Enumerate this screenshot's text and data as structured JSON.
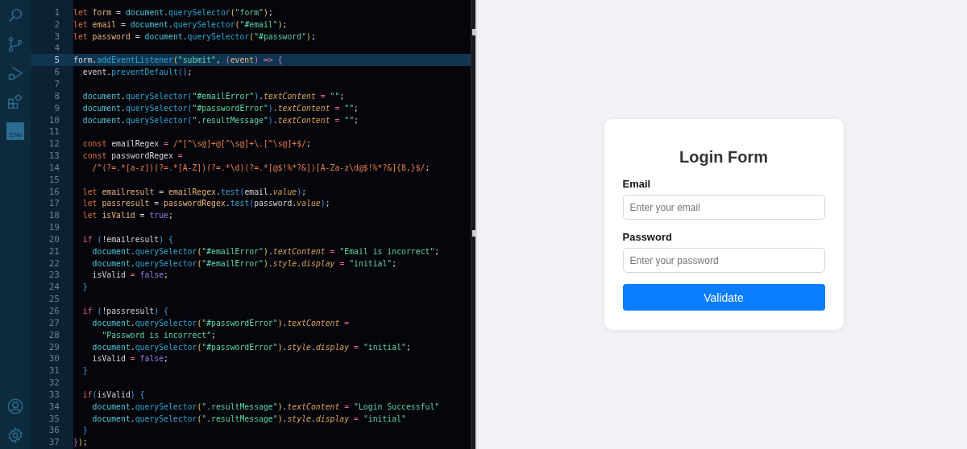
{
  "editor": {
    "lines": [
      {
        "number": "1",
        "selected": false,
        "tokens": [
          {
            "text": "let",
            "kind": "kw"
          },
          {
            "text": " form",
            "kind": "var"
          },
          {
            "text": " = ",
            "kind": "plain"
          },
          {
            "text": "document",
            "kind": "obj"
          },
          {
            "text": ".",
            "kind": "plain"
          },
          {
            "text": "querySelector",
            "kind": "fn"
          },
          {
            "text": "(",
            "kind": "paren"
          },
          {
            "text": "\"form\"",
            "kind": "str"
          },
          {
            "text": ")",
            "kind": "paren"
          },
          {
            "text": ";",
            "kind": "plain"
          }
        ]
      },
      {
        "number": "2",
        "selected": false,
        "tokens": [
          {
            "text": "let",
            "kind": "kw"
          },
          {
            "text": " email",
            "kind": "var"
          },
          {
            "text": " = ",
            "kind": "plain"
          },
          {
            "text": "document",
            "kind": "obj"
          },
          {
            "text": ".",
            "kind": "plain"
          },
          {
            "text": "querySelector",
            "kind": "fn"
          },
          {
            "text": "(",
            "kind": "paren"
          },
          {
            "text": "\"#email\"",
            "kind": "str"
          },
          {
            "text": ")",
            "kind": "paren"
          },
          {
            "text": ";",
            "kind": "plain"
          }
        ]
      },
      {
        "number": "3",
        "selected": false,
        "tokens": [
          {
            "text": "let",
            "kind": "kw"
          },
          {
            "text": " password",
            "kind": "var"
          },
          {
            "text": " = ",
            "kind": "plain"
          },
          {
            "text": "document",
            "kind": "obj"
          },
          {
            "text": ".",
            "kind": "plain"
          },
          {
            "text": "querySelector",
            "kind": "fn"
          },
          {
            "text": "(",
            "kind": "paren"
          },
          {
            "text": "\"#password\"",
            "kind": "str"
          },
          {
            "text": ")",
            "kind": "paren"
          },
          {
            "text": ";",
            "kind": "plain"
          }
        ]
      },
      {
        "number": "4",
        "selected": false
      },
      {
        "number": "5",
        "selected": true,
        "tokens": [
          {
            "text": "form",
            "kind": "plain"
          },
          {
            "text": ".",
            "kind": "plain"
          },
          {
            "text": "addEventListener",
            "kind": "fn"
          },
          {
            "text": "(",
            "kind": "paren"
          },
          {
            "text": "\"submit\"",
            "kind": "str"
          },
          {
            "text": ", ",
            "kind": "plain"
          },
          {
            "text": "(",
            "kind": "bracket"
          },
          {
            "text": "event",
            "kind": "var"
          },
          {
            "text": ")",
            "kind": "bracket"
          },
          {
            "text": " => ",
            "kind": "op"
          },
          {
            "text": "{",
            "kind": "bracket"
          }
        ]
      },
      {
        "number": "6",
        "selected": false,
        "tokens": [
          {
            "text": "  event",
            "kind": "plain"
          },
          {
            "text": ".",
            "kind": "plain"
          },
          {
            "text": "preventDefault",
            "kind": "fn"
          },
          {
            "text": "()",
            "kind": "brace"
          },
          {
            "text": ";",
            "kind": "plain"
          }
        ]
      },
      {
        "number": "7",
        "selected": false
      },
      {
        "number": "8",
        "selected": false,
        "tokens": [
          {
            "text": "  document",
            "kind": "obj"
          },
          {
            "text": ".",
            "kind": "plain"
          },
          {
            "text": "querySelector",
            "kind": "fn"
          },
          {
            "text": "(",
            "kind": "brace"
          },
          {
            "text": "\"#emailError\"",
            "kind": "str"
          },
          {
            "text": ")",
            "kind": "brace"
          },
          {
            "text": ".",
            "kind": "plain"
          },
          {
            "text": "textContent",
            "kind": "prop"
          },
          {
            "text": " = ",
            "kind": "op"
          },
          {
            "text": "\"\"",
            "kind": "str"
          },
          {
            "text": ";",
            "kind": "plain"
          }
        ]
      },
      {
        "number": "9",
        "selected": false,
        "tokens": [
          {
            "text": "  document",
            "kind": "obj"
          },
          {
            "text": ".",
            "kind": "plain"
          },
          {
            "text": "querySelector",
            "kind": "fn"
          },
          {
            "text": "(",
            "kind": "brace"
          },
          {
            "text": "\"#passwordError\"",
            "kind": "str"
          },
          {
            "text": ")",
            "kind": "brace"
          },
          {
            "text": ".",
            "kind": "plain"
          },
          {
            "text": "textContent",
            "kind": "prop"
          },
          {
            "text": " = ",
            "kind": "op"
          },
          {
            "text": "\"\"",
            "kind": "str"
          },
          {
            "text": ";",
            "kind": "plain"
          }
        ]
      },
      {
        "number": "10",
        "selected": false,
        "tokens": [
          {
            "text": "  document",
            "kind": "obj"
          },
          {
            "text": ".",
            "kind": "plain"
          },
          {
            "text": "querySelector",
            "kind": "fn"
          },
          {
            "text": "(",
            "kind": "brace"
          },
          {
            "text": "\".resultMessage\"",
            "kind": "str"
          },
          {
            "text": ")",
            "kind": "brace"
          },
          {
            "text": ".",
            "kind": "plain"
          },
          {
            "text": "textContent",
            "kind": "prop"
          },
          {
            "text": " = ",
            "kind": "op"
          },
          {
            "text": "\"\"",
            "kind": "str"
          },
          {
            "text": ";",
            "kind": "plain"
          }
        ]
      },
      {
        "number": "11",
        "selected": false
      },
      {
        "number": "12",
        "selected": false,
        "tokens": [
          {
            "text": "  const",
            "kind": "kw"
          },
          {
            "text": " emailRegex",
            "kind": "plain"
          },
          {
            "text": " = ",
            "kind": "op"
          },
          {
            "text": "/^[^\\s@]+@[^\\s@]+\\.[^\\s@]+$/",
            "kind": "regex"
          },
          {
            "text": ";",
            "kind": "plain"
          }
        ]
      },
      {
        "number": "13",
        "selected": false,
        "tokens": [
          {
            "text": "  const",
            "kind": "kw"
          },
          {
            "text": " passwordRegex",
            "kind": "plain"
          },
          {
            "text": " =",
            "kind": "op"
          }
        ]
      },
      {
        "number": "14",
        "selected": false,
        "tokens": [
          {
            "text": "    /^(?=.*[a-z])(?=.*[A-Z])(?=.*\\d)(?=.*[@$!%*?&])[A-Za-z\\d@$!%*?&]{8,}$/",
            "kind": "regex"
          },
          {
            "text": ";",
            "kind": "plain"
          }
        ]
      },
      {
        "number": "15",
        "selected": false
      },
      {
        "number": "16",
        "selected": false,
        "tokens": [
          {
            "text": "  let",
            "kind": "kw"
          },
          {
            "text": " emailresult",
            "kind": "var"
          },
          {
            "text": " = ",
            "kind": "plain"
          },
          {
            "text": "emailRegex",
            "kind": "var"
          },
          {
            "text": ".",
            "kind": "plain"
          },
          {
            "text": "test",
            "kind": "fn"
          },
          {
            "text": "(",
            "kind": "brace"
          },
          {
            "text": "email",
            "kind": "plain"
          },
          {
            "text": ".",
            "kind": "plain"
          },
          {
            "text": "value",
            "kind": "prop"
          },
          {
            "text": ")",
            "kind": "brace"
          },
          {
            "text": ";",
            "kind": "plain"
          }
        ]
      },
      {
        "number": "17",
        "selected": false,
        "tokens": [
          {
            "text": "  let",
            "kind": "kw"
          },
          {
            "text": " passresult",
            "kind": "var"
          },
          {
            "text": " = ",
            "kind": "plain"
          },
          {
            "text": "passwordRegex",
            "kind": "var"
          },
          {
            "text": ".",
            "kind": "plain"
          },
          {
            "text": "test",
            "kind": "fn"
          },
          {
            "text": "(",
            "kind": "brace"
          },
          {
            "text": "password",
            "kind": "plain"
          },
          {
            "text": ".",
            "kind": "plain"
          },
          {
            "text": "value",
            "kind": "prop"
          },
          {
            "text": ")",
            "kind": "brace"
          },
          {
            "text": ";",
            "kind": "plain"
          }
        ]
      },
      {
        "number": "18",
        "selected": false,
        "tokens": [
          {
            "text": "  let",
            "kind": "kw"
          },
          {
            "text": " isValid",
            "kind": "var"
          },
          {
            "text": " = ",
            "kind": "plain"
          },
          {
            "text": "true",
            "kind": "bool"
          },
          {
            "text": ";",
            "kind": "plain"
          }
        ]
      },
      {
        "number": "19",
        "selected": false
      },
      {
        "number": "20",
        "selected": false,
        "tokens": [
          {
            "text": "  if",
            "kind": "ctrl"
          },
          {
            "text": " (",
            "kind": "brace"
          },
          {
            "text": "!emailresult",
            "kind": "plain"
          },
          {
            "text": ")",
            "kind": "brace"
          },
          {
            "text": " {",
            "kind": "brace"
          }
        ]
      },
      {
        "number": "21",
        "selected": false,
        "tokens": [
          {
            "text": "    document",
            "kind": "obj"
          },
          {
            "text": ".",
            "kind": "plain"
          },
          {
            "text": "querySelector",
            "kind": "fn"
          },
          {
            "text": "(",
            "kind": "paren"
          },
          {
            "text": "\"#emailError\"",
            "kind": "str"
          },
          {
            "text": ")",
            "kind": "paren"
          },
          {
            "text": ".",
            "kind": "plain"
          },
          {
            "text": "textContent",
            "kind": "prop"
          },
          {
            "text": " = ",
            "kind": "op"
          },
          {
            "text": "\"Email is incorrect\"",
            "kind": "str"
          },
          {
            "text": ";",
            "kind": "plain"
          }
        ]
      },
      {
        "number": "22",
        "selected": false,
        "tokens": [
          {
            "text": "    document",
            "kind": "obj"
          },
          {
            "text": ".",
            "kind": "plain"
          },
          {
            "text": "querySelector",
            "kind": "fn"
          },
          {
            "text": "(",
            "kind": "paren"
          },
          {
            "text": "\"#emailError\"",
            "kind": "str"
          },
          {
            "text": ")",
            "kind": "paren"
          },
          {
            "text": ".",
            "kind": "plain"
          },
          {
            "text": "style",
            "kind": "prop"
          },
          {
            "text": ".",
            "kind": "plain"
          },
          {
            "text": "display",
            "kind": "prop"
          },
          {
            "text": " = ",
            "kind": "op"
          },
          {
            "text": "\"initial\"",
            "kind": "str"
          },
          {
            "text": ";",
            "kind": "plain"
          }
        ]
      },
      {
        "number": "23",
        "selected": false,
        "tokens": [
          {
            "text": "    isValid",
            "kind": "plain"
          },
          {
            "text": " = ",
            "kind": "op"
          },
          {
            "text": "false",
            "kind": "bool"
          },
          {
            "text": ";",
            "kind": "plain"
          }
        ]
      },
      {
        "number": "24",
        "selected": false,
        "tokens": [
          {
            "text": "  }",
            "kind": "brace"
          }
        ]
      },
      {
        "number": "25",
        "selected": false
      },
      {
        "number": "26",
        "selected": false,
        "tokens": [
          {
            "text": "  if",
            "kind": "ctrl"
          },
          {
            "text": " (",
            "kind": "brace"
          },
          {
            "text": "!passresult",
            "kind": "plain"
          },
          {
            "text": ")",
            "kind": "brace"
          },
          {
            "text": " {",
            "kind": "brace"
          }
        ]
      },
      {
        "number": "27",
        "selected": false,
        "tokens": [
          {
            "text": "    document",
            "kind": "obj"
          },
          {
            "text": ".",
            "kind": "plain"
          },
          {
            "text": "querySelector",
            "kind": "fn"
          },
          {
            "text": "(",
            "kind": "paren"
          },
          {
            "text": "\"#passwordError\"",
            "kind": "str"
          },
          {
            "text": ")",
            "kind": "paren"
          },
          {
            "text": ".",
            "kind": "plain"
          },
          {
            "text": "textContent",
            "kind": "prop"
          },
          {
            "text": " =",
            "kind": "op"
          }
        ]
      },
      {
        "number": "28",
        "selected": false,
        "tokens": [
          {
            "text": "      \"Password is incorrect\"",
            "kind": "str"
          },
          {
            "text": ";",
            "kind": "plain"
          }
        ]
      },
      {
        "number": "29",
        "selected": false,
        "tokens": [
          {
            "text": "    document",
            "kind": "obj"
          },
          {
            "text": ".",
            "kind": "plain"
          },
          {
            "text": "querySelector",
            "kind": "fn"
          },
          {
            "text": "(",
            "kind": "paren"
          },
          {
            "text": "\"#passwordError\"",
            "kind": "str"
          },
          {
            "text": ")",
            "kind": "paren"
          },
          {
            "text": ".",
            "kind": "plain"
          },
          {
            "text": "style",
            "kind": "prop"
          },
          {
            "text": ".",
            "kind": "plain"
          },
          {
            "text": "display",
            "kind": "prop"
          },
          {
            "text": " = ",
            "kind": "op"
          },
          {
            "text": "\"initial\"",
            "kind": "str"
          },
          {
            "text": ";",
            "kind": "plain"
          }
        ]
      },
      {
        "number": "30",
        "selected": false,
        "tokens": [
          {
            "text": "    isValid",
            "kind": "plain"
          },
          {
            "text": " = ",
            "kind": "op"
          },
          {
            "text": "false",
            "kind": "bool"
          },
          {
            "text": ";",
            "kind": "plain"
          }
        ]
      },
      {
        "number": "31",
        "selected": false,
        "tokens": [
          {
            "text": "  }",
            "kind": "brace"
          }
        ]
      },
      {
        "number": "32",
        "selected": false
      },
      {
        "number": "33",
        "selected": false,
        "tokens": [
          {
            "text": "  if",
            "kind": "ctrl"
          },
          {
            "text": "(",
            "kind": "brace"
          },
          {
            "text": "isValid",
            "kind": "plain"
          },
          {
            "text": ")",
            "kind": "brace"
          },
          {
            "text": " {",
            "kind": "brace"
          }
        ]
      },
      {
        "number": "34",
        "selected": false,
        "tokens": [
          {
            "text": "    document",
            "kind": "obj"
          },
          {
            "text": ".",
            "kind": "plain"
          },
          {
            "text": "querySelector",
            "kind": "fn"
          },
          {
            "text": "(",
            "kind": "paren"
          },
          {
            "text": "\".resultMessage\"",
            "kind": "str"
          },
          {
            "text": ")",
            "kind": "paren"
          },
          {
            "text": ".",
            "kind": "plain"
          },
          {
            "text": "textContent",
            "kind": "prop"
          },
          {
            "text": " = ",
            "kind": "op"
          },
          {
            "text": "\"Login Successful\"",
            "kind": "str"
          }
        ]
      },
      {
        "number": "35",
        "selected": false,
        "tokens": [
          {
            "text": "    document",
            "kind": "obj"
          },
          {
            "text": ".",
            "kind": "plain"
          },
          {
            "text": "querySelector",
            "kind": "fn"
          },
          {
            "text": "(",
            "kind": "paren"
          },
          {
            "text": "\".resultMessage\"",
            "kind": "str"
          },
          {
            "text": ")",
            "kind": "paren"
          },
          {
            "text": ".",
            "kind": "plain"
          },
          {
            "text": "style",
            "kind": "prop"
          },
          {
            "text": ".",
            "kind": "plain"
          },
          {
            "text": "display",
            "kind": "prop"
          },
          {
            "text": " = ",
            "kind": "op"
          },
          {
            "text": "\"initial\"",
            "kind": "str"
          }
        ]
      },
      {
        "number": "36",
        "selected": false,
        "tokens": [
          {
            "text": "  }",
            "kind": "brace"
          }
        ]
      },
      {
        "number": "37",
        "selected": false,
        "tokens": [
          {
            "text": "}",
            "kind": "bracket"
          },
          {
            "text": ")",
            "kind": "paren"
          },
          {
            "text": ";",
            "kind": "plain"
          }
        ]
      }
    ]
  },
  "activity_bar": {
    "env_label": ".ENV"
  },
  "login": {
    "title": "Login Form",
    "fields": [
      {
        "label": "Email",
        "placeholder": "Enter your email"
      },
      {
        "label": "Password",
        "placeholder": "Enter your password"
      }
    ],
    "button": "Validate"
  }
}
